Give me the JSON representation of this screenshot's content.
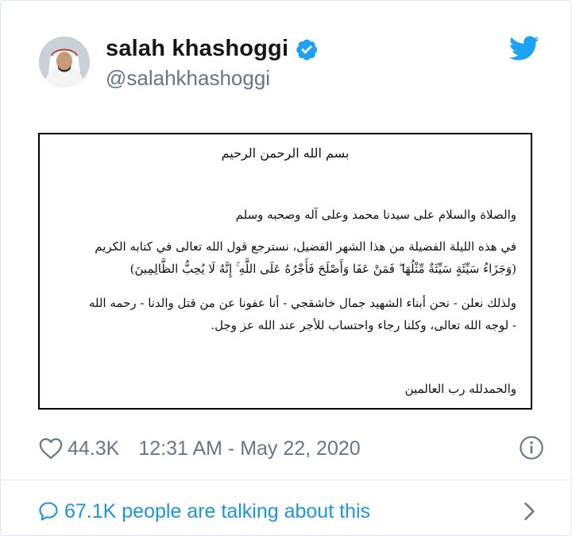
{
  "author": {
    "name": "salah khashoggi",
    "handle": "@salahkhashoggi",
    "verified": true
  },
  "document": {
    "basmala": "بسم الله الرحمن الرحيم",
    "line1": "والصلاة والسلام على سيدنا محمد وعلى آله وصحبه وسلم",
    "line2": "في هذه الليلة الفضيلة من هذا الشهر الفضيل، نسترجع قول الله تعالى في كتابه الكريم",
    "line3": "(وَجَزَاءُ سَيِّئَةٍ سَيِّئَةٌ مِّثْلُهَا ۖ فَمَنْ عَفَا وَأَصْلَحَ فَأَجْرُهُ عَلَى اللَّهِ ۚ إِنَّهُ لَا يُحِبُّ الظَّالِمِينَ)",
    "line4": "ولذلك نعلن - نحن أبناء الشهيد جمال خاشقجي - أنا عفونا عن من قتل والدنا - رحمه الله",
    "line5": "- لوجه الله تعالى، وكلنا رجاء واحتساب للأجر عند الله عز وجل.",
    "closing": "والحمدلله رب العالمين"
  },
  "meta": {
    "likes": "44.3K",
    "timestamp": "12:31 AM - May 22, 2020"
  },
  "conversation": {
    "text": "67.1K people are talking about this"
  },
  "colors": {
    "accent": "#1da1f2",
    "link": "#1b95e0",
    "muted": "#657786"
  },
  "icons": [
    "verified-badge-icon",
    "twitter-bird-icon",
    "heart-icon",
    "info-icon",
    "chat-bubble-icon",
    "chevron-right-icon"
  ]
}
